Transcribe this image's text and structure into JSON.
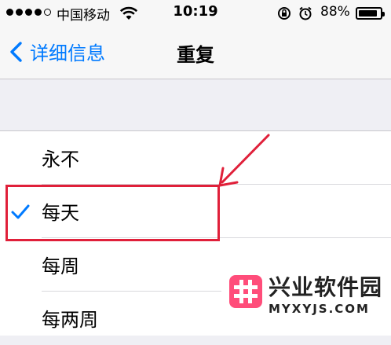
{
  "status_bar": {
    "carrier": "中国移动",
    "time": "10:19",
    "battery_percent": "88%",
    "battery_level": 0.88,
    "signal_bars_filled": 4,
    "signal_bars_total": 5
  },
  "nav": {
    "back_label": "详细信息",
    "title": "重复"
  },
  "options": [
    {
      "label": "永不",
      "checked": false
    },
    {
      "label": "每天",
      "checked": true
    },
    {
      "label": "每周",
      "checked": false
    },
    {
      "label": "每两周",
      "checked": false
    }
  ],
  "watermark": {
    "name": "兴业软件园",
    "url": "MYXYJS.COM"
  },
  "colors": {
    "accent": "#007aff",
    "annotation": "#e0203a",
    "watermark_logo": "#ff4d7a"
  }
}
